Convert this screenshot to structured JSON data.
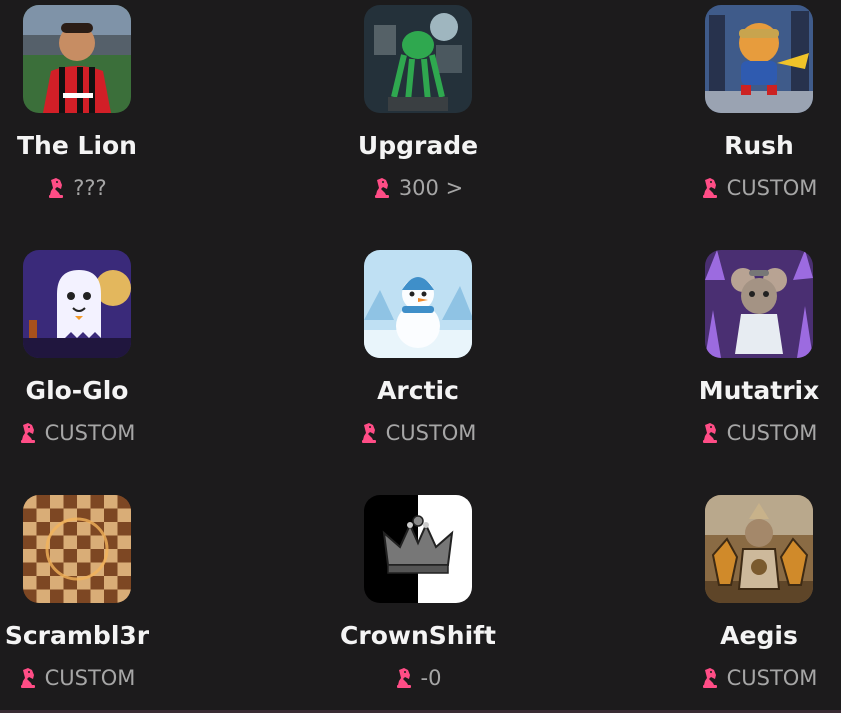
{
  "colors": {
    "background": "#1c1b1c",
    "name_text": "#f4f4f4",
    "meta_text": "#a6a6a6",
    "knight_accent": "#ff4d86"
  },
  "bots": [
    {
      "name": "The Lion",
      "meta_icon": "knight-icon",
      "meta": "???",
      "thumb": "lion-thumbnail"
    },
    {
      "name": "Upgrade",
      "meta_icon": "knight-icon",
      "meta": "300 >",
      "thumb": "upgrade-thumbnail"
    },
    {
      "name": "Rush",
      "meta_icon": "knight-icon",
      "meta": "CUSTOM",
      "thumb": "rush-thumbnail"
    },
    {
      "name": "Glo-Glo",
      "meta_icon": "knight-icon",
      "meta": "CUSTOM",
      "thumb": "glo-glo-thumbnail"
    },
    {
      "name": "Arctic",
      "meta_icon": "knight-icon",
      "meta": "CUSTOM",
      "thumb": "arctic-thumbnail"
    },
    {
      "name": "Mutatrix",
      "meta_icon": "knight-icon",
      "meta": "CUSTOM",
      "thumb": "mutatrix-thumbnail"
    },
    {
      "name": "Scrambl3r",
      "meta_icon": "knight-icon",
      "meta": "CUSTOM",
      "thumb": "scrambl3r-thumbnail"
    },
    {
      "name": "CrownShift",
      "meta_icon": "knight-icon",
      "meta": "-0",
      "thumb": "crownshift-thumbnail"
    },
    {
      "name": "Aegis",
      "meta_icon": "knight-icon",
      "meta": "CUSTOM",
      "thumb": "aegis-thumbnail"
    }
  ]
}
